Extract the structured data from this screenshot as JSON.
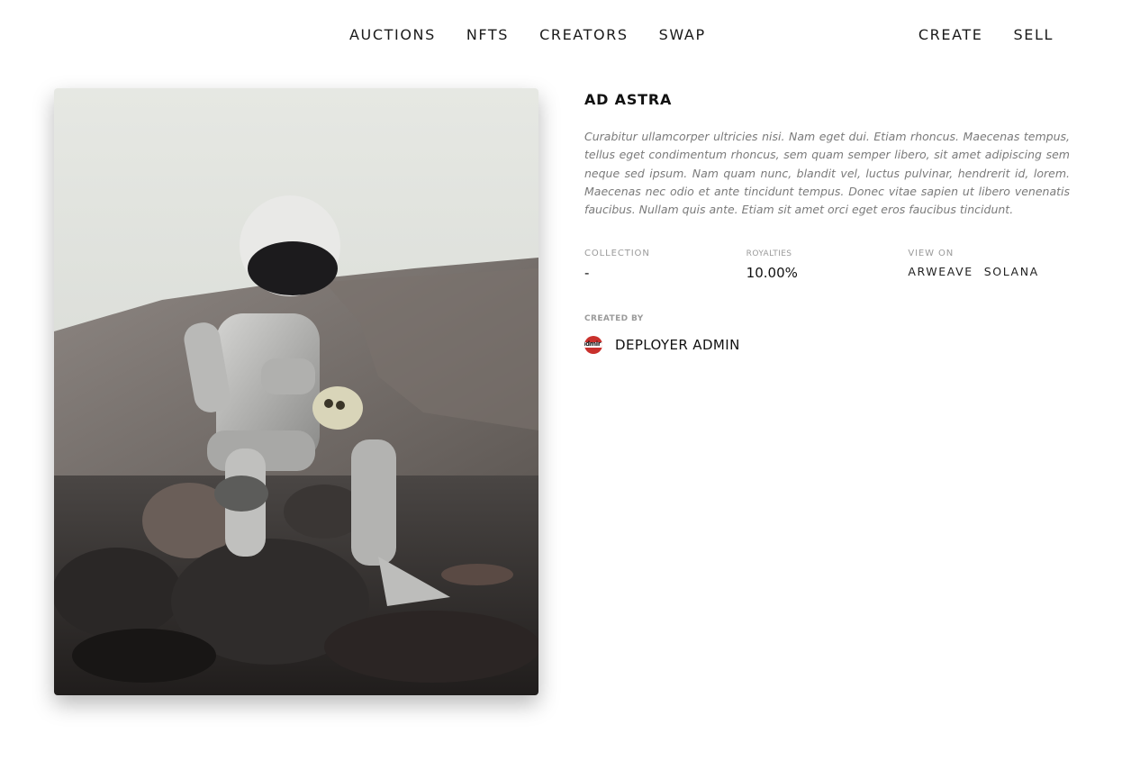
{
  "nav": {
    "center": [
      "AUCTIONS",
      "NFTS",
      "CREATORS",
      "SWAP"
    ],
    "right": [
      "CREATE",
      "SELL"
    ]
  },
  "artwork": {
    "subject": "astronaut-holding-skull-on-rocky-slope"
  },
  "item": {
    "title": "AD ASTRA",
    "description": "Curabitur ullamcorper ultricies nisi. Nam eget dui. Etiam rhoncus. Maecenas tempus, tellus eget condimentum rhoncus, sem quam semper libero, sit amet adipiscing sem neque sed ipsum. Nam quam nunc, blandit vel, luctus pulvinar, hendrerit id, lorem. Maecenas nec odio et ante tincidunt tempus. Donec vitae sapien ut libero venenatis faucibus. Nullam quis ante. Etiam sit amet orci eget eros faucibus tincidunt.",
    "collection_label": "COLLECTION",
    "collection_value": "-",
    "royalties_label": "ROYALTIES",
    "royalties_value": "10.00%",
    "view_on_label": "VIEW ON",
    "view_on_links": [
      "ARWEAVE",
      "SOLANA"
    ],
    "created_by_label": "CREATED BY",
    "creator_name": "DEPLOYER ADMIN",
    "avatar_text": "idmir"
  },
  "colors": {
    "text": "#111111",
    "muted": "#7a7a7a",
    "label": "#9a9a9a",
    "avatar": "#c9302c"
  }
}
